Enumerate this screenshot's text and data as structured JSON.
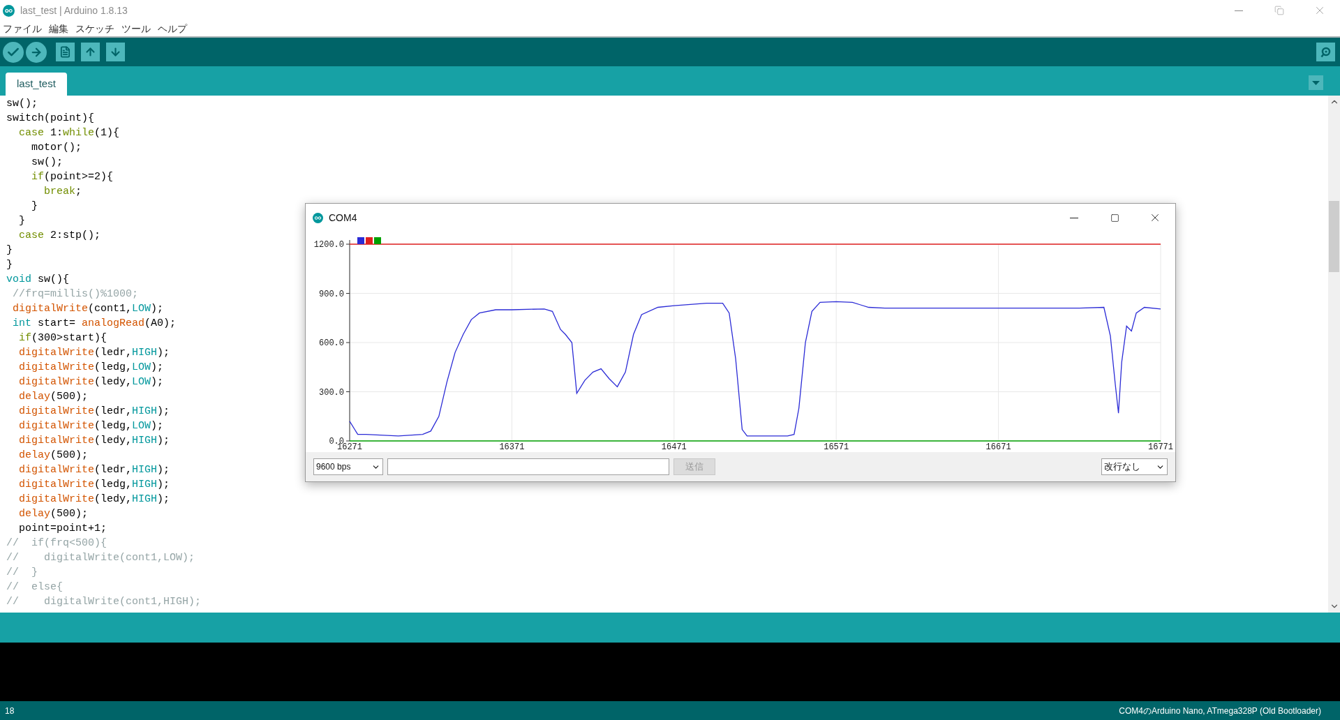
{
  "window": {
    "title": "last_test | Arduino 1.8.13"
  },
  "menu": [
    "ファイル",
    "編集",
    "スケッチ",
    "ツール",
    "ヘルプ"
  ],
  "tabs": [
    {
      "label": "last_test",
      "selected": true
    }
  ],
  "code": [
    [
      {
        "kind": "plain",
        "text": "sw();"
      }
    ],
    [
      {
        "kind": "plain",
        "text": "switch(point){"
      }
    ],
    [
      {
        "kind": "control",
        "text": "  case"
      },
      {
        "kind": "plain",
        "text": " 1:"
      },
      {
        "kind": "control",
        "text": "while"
      },
      {
        "kind": "plain",
        "text": "(1){"
      }
    ],
    [
      {
        "kind": "plain",
        "text": "    motor();"
      }
    ],
    [
      {
        "kind": "plain",
        "text": "    sw();"
      }
    ],
    [
      {
        "kind": "control",
        "text": "    if"
      },
      {
        "kind": "plain",
        "text": "(point>=2){"
      }
    ],
    [
      {
        "kind": "control",
        "text": "      break"
      },
      {
        "kind": "plain",
        "text": ";"
      }
    ],
    [
      {
        "kind": "plain",
        "text": "    }"
      }
    ],
    [
      {
        "kind": "plain",
        "text": "  }"
      }
    ],
    [
      {
        "kind": "control",
        "text": "  case"
      },
      {
        "kind": "plain",
        "text": " 2:stp();"
      }
    ],
    [
      {
        "kind": "plain",
        "text": "}"
      }
    ],
    [
      {
        "kind": "plain",
        "text": "}"
      }
    ],
    [
      {
        "kind": "type",
        "text": "void"
      },
      {
        "kind": "plain",
        "text": " sw(){"
      }
    ],
    [
      {
        "kind": "comment",
        "text": " //frq=millis()%1000;"
      }
    ],
    [
      {
        "kind": "function",
        "text": " digitalWrite"
      },
      {
        "kind": "plain",
        "text": "(cont1,"
      },
      {
        "kind": "type",
        "text": "LOW"
      },
      {
        "kind": "plain",
        "text": ");"
      }
    ],
    [
      {
        "kind": "type",
        "text": " int"
      },
      {
        "kind": "plain",
        "text": " start= "
      },
      {
        "kind": "function",
        "text": "analogRead"
      },
      {
        "kind": "plain",
        "text": "(A0);"
      }
    ],
    [
      {
        "kind": "control",
        "text": "  if"
      },
      {
        "kind": "plain",
        "text": "(300>start){"
      }
    ],
    [
      {
        "kind": "function",
        "text": "  digitalWrite"
      },
      {
        "kind": "plain",
        "text": "(ledr,"
      },
      {
        "kind": "type",
        "text": "HIGH"
      },
      {
        "kind": "plain",
        "text": ");"
      }
    ],
    [
      {
        "kind": "function",
        "text": "  digitalWrite"
      },
      {
        "kind": "plain",
        "text": "(ledg,"
      },
      {
        "kind": "type",
        "text": "LOW"
      },
      {
        "kind": "plain",
        "text": ");"
      }
    ],
    [
      {
        "kind": "function",
        "text": "  digitalWrite"
      },
      {
        "kind": "plain",
        "text": "(ledy,"
      },
      {
        "kind": "type",
        "text": "LOW"
      },
      {
        "kind": "plain",
        "text": ");"
      }
    ],
    [
      {
        "kind": "function",
        "text": "  delay"
      },
      {
        "kind": "plain",
        "text": "(500);"
      }
    ],
    [
      {
        "kind": "function",
        "text": "  digitalWrite"
      },
      {
        "kind": "plain",
        "text": "(ledr,"
      },
      {
        "kind": "type",
        "text": "HIGH"
      },
      {
        "kind": "plain",
        "text": ");"
      }
    ],
    [
      {
        "kind": "function",
        "text": "  digitalWrite"
      },
      {
        "kind": "plain",
        "text": "(ledg,"
      },
      {
        "kind": "type",
        "text": "LOW"
      },
      {
        "kind": "plain",
        "text": ");"
      }
    ],
    [
      {
        "kind": "function",
        "text": "  digitalWrite"
      },
      {
        "kind": "plain",
        "text": "(ledy,"
      },
      {
        "kind": "type",
        "text": "HIGH"
      },
      {
        "kind": "plain",
        "text": ");"
      }
    ],
    [
      {
        "kind": "function",
        "text": "  delay"
      },
      {
        "kind": "plain",
        "text": "(500);"
      }
    ],
    [
      {
        "kind": "function",
        "text": "  digitalWrite"
      },
      {
        "kind": "plain",
        "text": "(ledr,"
      },
      {
        "kind": "type",
        "text": "HIGH"
      },
      {
        "kind": "plain",
        "text": ");"
      }
    ],
    [
      {
        "kind": "function",
        "text": "  digitalWrite"
      },
      {
        "kind": "plain",
        "text": "(ledg,"
      },
      {
        "kind": "type",
        "text": "HIGH"
      },
      {
        "kind": "plain",
        "text": ");"
      }
    ],
    [
      {
        "kind": "function",
        "text": "  digitalWrite"
      },
      {
        "kind": "plain",
        "text": "(ledy,"
      },
      {
        "kind": "type",
        "text": "HIGH"
      },
      {
        "kind": "plain",
        "text": ");"
      }
    ],
    [
      {
        "kind": "function",
        "text": "  delay"
      },
      {
        "kind": "plain",
        "text": "(500);"
      }
    ],
    [
      {
        "kind": "plain",
        "text": "  point=point+1;"
      }
    ],
    [
      {
        "kind": "comment",
        "text": "//  if(frq<500){"
      }
    ],
    [
      {
        "kind": "comment",
        "text": "//    digitalWrite(cont1,LOW);"
      }
    ],
    [
      {
        "kind": "comment",
        "text": "//  }"
      }
    ],
    [
      {
        "kind": "comment",
        "text": "//  else{"
      }
    ],
    [
      {
        "kind": "comment",
        "text": "//    digitalWrite(cont1,HIGH);"
      }
    ]
  ],
  "plotter": {
    "title": "COM4",
    "chart_data": {
      "type": "line",
      "grid": true,
      "x": [
        16271,
        16276,
        16281,
        16301,
        16316,
        16321,
        16326,
        16331,
        16336,
        16341,
        16346,
        16351,
        16361,
        16371,
        16391,
        16396,
        16401,
        16404,
        16408,
        16411,
        16416,
        16421,
        16426,
        16431,
        16436,
        16441,
        16446,
        16451,
        16461,
        16471,
        16491,
        16501,
        16505,
        16509,
        16513,
        16516,
        16521,
        16541,
        16545,
        16548,
        16552,
        16556,
        16561,
        16571,
        16581,
        16586,
        16591,
        16601,
        16721,
        16736,
        16740,
        16743,
        16745,
        16747,
        16750,
        16753,
        16756,
        16761,
        16771
      ],
      "series": [
        {
          "color": "#2b2bd6",
          "values": [
            120,
            40,
            40,
            30,
            40,
            60,
            150,
            360,
            540,
            650,
            740,
            780,
            800,
            800,
            805,
            790,
            680,
            650,
            600,
            290,
            370,
            420,
            440,
            380,
            330,
            420,
            650,
            770,
            815,
            825,
            840,
            840,
            780,
            500,
            70,
            30,
            30,
            30,
            40,
            200,
            600,
            790,
            845,
            850,
            845,
            830,
            815,
            810,
            810,
            815,
            640,
            350,
            170,
            480,
            700,
            670,
            780,
            815,
            805
          ]
        },
        {
          "color": "#e02020",
          "values": [
            1200,
            1200,
            1200,
            1200,
            1200,
            1200,
            1200,
            1200,
            1200,
            1200,
            1200,
            1200,
            1200,
            1200,
            1200,
            1200,
            1200,
            1200,
            1200,
            1200,
            1200,
            1200,
            1200,
            1200,
            1200,
            1200,
            1200,
            1200,
            1200,
            1200,
            1200,
            1200,
            1200,
            1200,
            1200,
            1200,
            1200,
            1200,
            1200,
            1200,
            1200,
            1200,
            1200,
            1200,
            1200,
            1200,
            1200,
            1200,
            1200,
            1200,
            1200,
            1200,
            1200,
            1200,
            1200,
            1200,
            1200,
            1200,
            1200
          ]
        },
        {
          "color": "#00a000",
          "values": [
            0,
            0,
            0,
            0,
            0,
            0,
            0,
            0,
            0,
            0,
            0,
            0,
            0,
            0,
            0,
            0,
            0,
            0,
            0,
            0,
            0,
            0,
            0,
            0,
            0,
            0,
            0,
            0,
            0,
            0,
            0,
            0,
            0,
            0,
            0,
            0,
            0,
            0,
            0,
            0,
            0,
            0,
            0,
            0,
            0,
            0,
            0,
            0,
            0,
            0,
            0,
            0,
            0,
            0,
            0,
            0,
            0,
            0,
            0
          ]
        }
      ],
      "xlim": [
        16271,
        16771
      ],
      "ylim": [
        0,
        1200
      ],
      "xticks": [
        16271,
        16371,
        16471,
        16571,
        16671,
        16771
      ],
      "yticks": [
        {
          "value": 0,
          "label": "0.0"
        },
        {
          "value": 300,
          "label": "300.0"
        },
        {
          "value": 600,
          "label": "600.0"
        },
        {
          "value": 900,
          "label": "900.0"
        },
        {
          "value": 1200,
          "label": "1200.0"
        }
      ]
    },
    "baud": "9600 bps",
    "send_button": {
      "label": "送信",
      "disabled": true
    },
    "line_ending": "改行なし"
  },
  "status_bar": {
    "line": "18",
    "board": "COM4のArduino Nano, ATmega328P (Old Bootloader)"
  }
}
